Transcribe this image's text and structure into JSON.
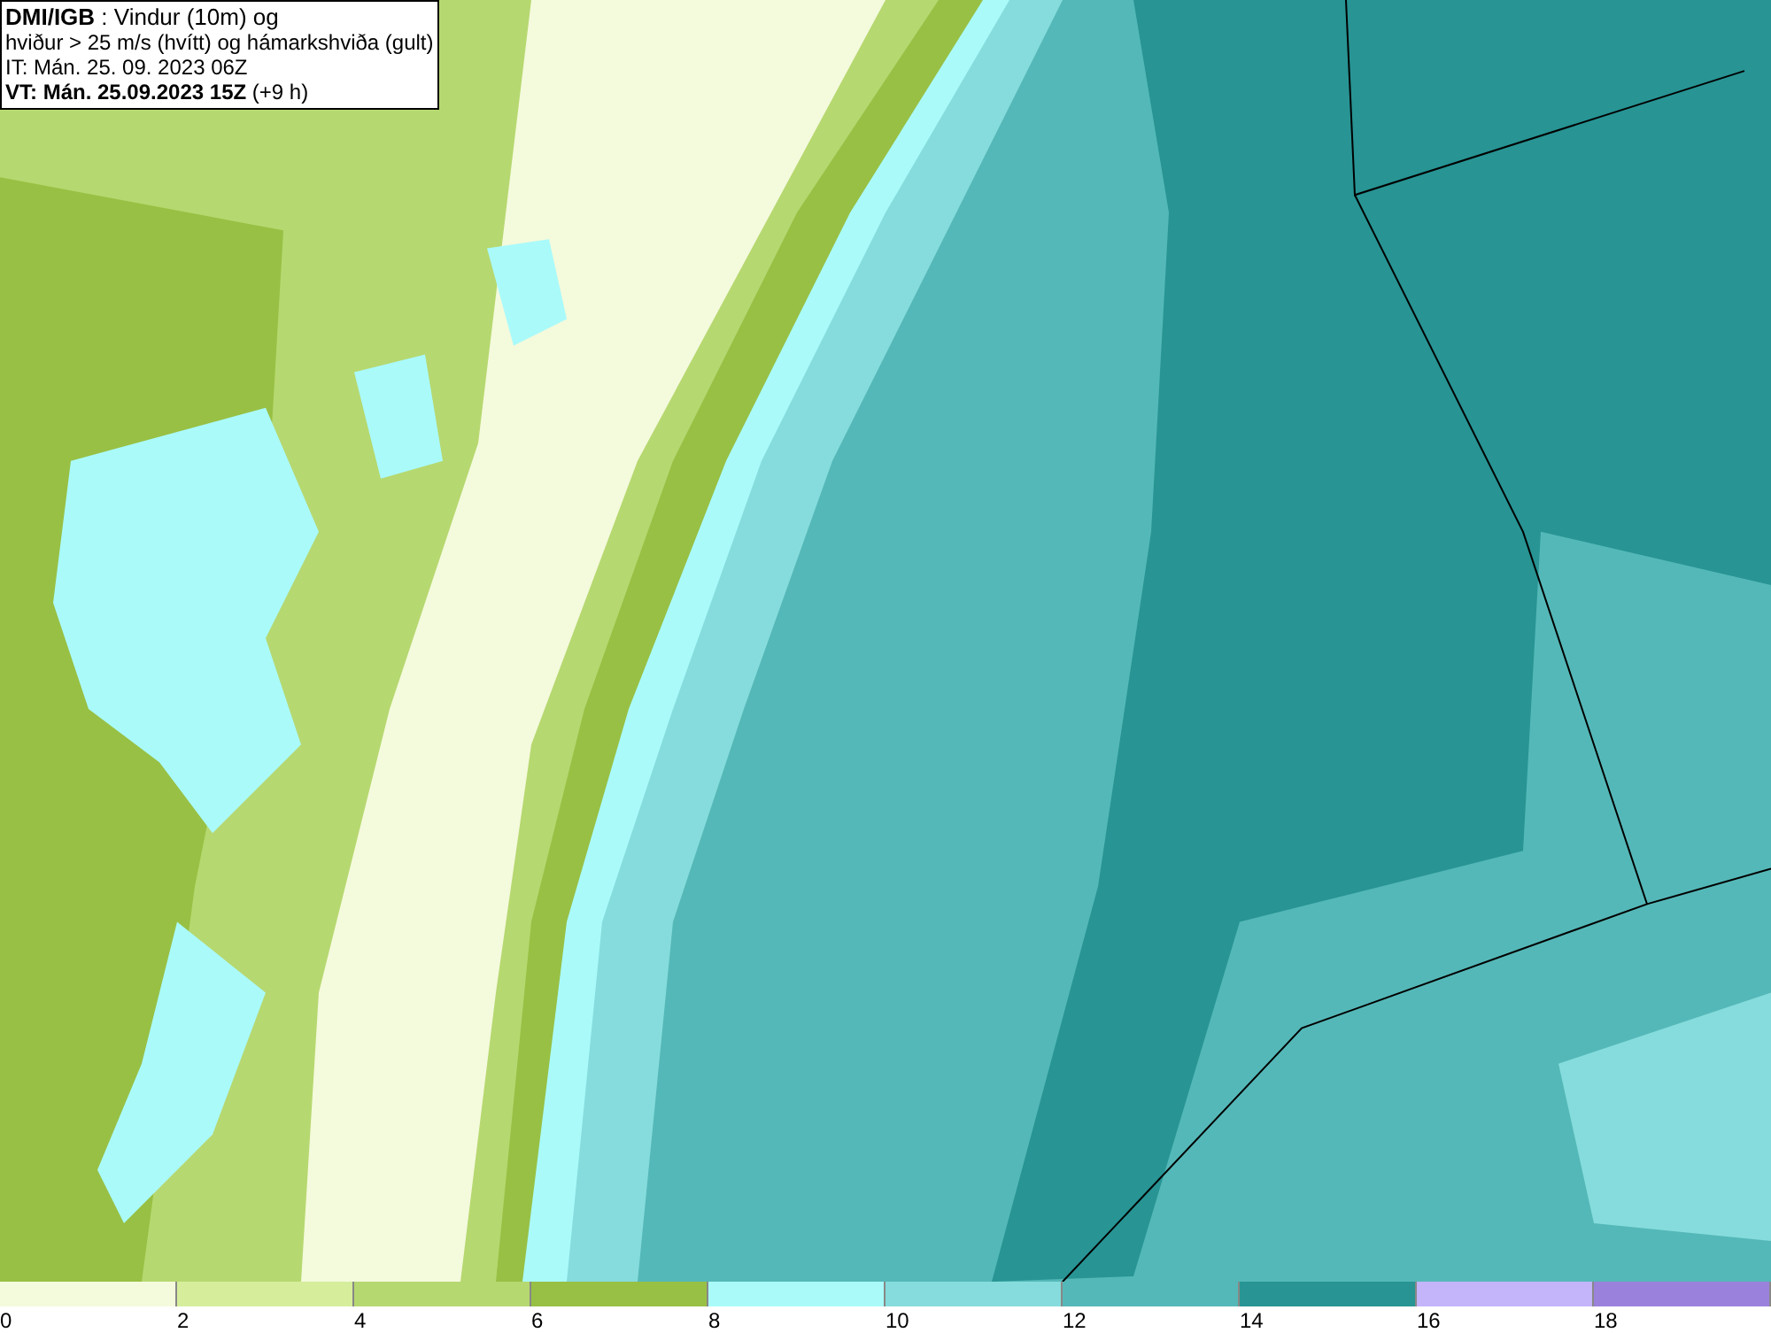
{
  "header": {
    "lines": [
      "**DMI/IGB** : Vindur (10m) og",
      "hviður > 25 m/s (hvítt) og hámarkshviða (gult)",
      "IT: Mán. 25. 09. 2023 06Z",
      "**VT: Mán. 25.09.2023 15Z** (+9 h)"
    ]
  },
  "legend": [
    {
      "label": "0",
      "color": "#f4fadc"
    },
    {
      "label": "2",
      "color": "#d6ee9c"
    },
    {
      "label": "4",
      "color": "#b6d870"
    },
    {
      "label": "6",
      "color": "#98c044"
    },
    {
      "label": "8",
      "color": "#aafafa"
    },
    {
      "label": "10",
      "color": "#86dcdc"
    },
    {
      "label": "12",
      "color": "#55b8b8"
    },
    {
      "label": "14",
      "color": "#289494"
    },
    {
      "label": "16",
      "color": "#c4b4fa"
    },
    {
      "label": "18",
      "color": "#9a82dc"
    }
  ]
}
